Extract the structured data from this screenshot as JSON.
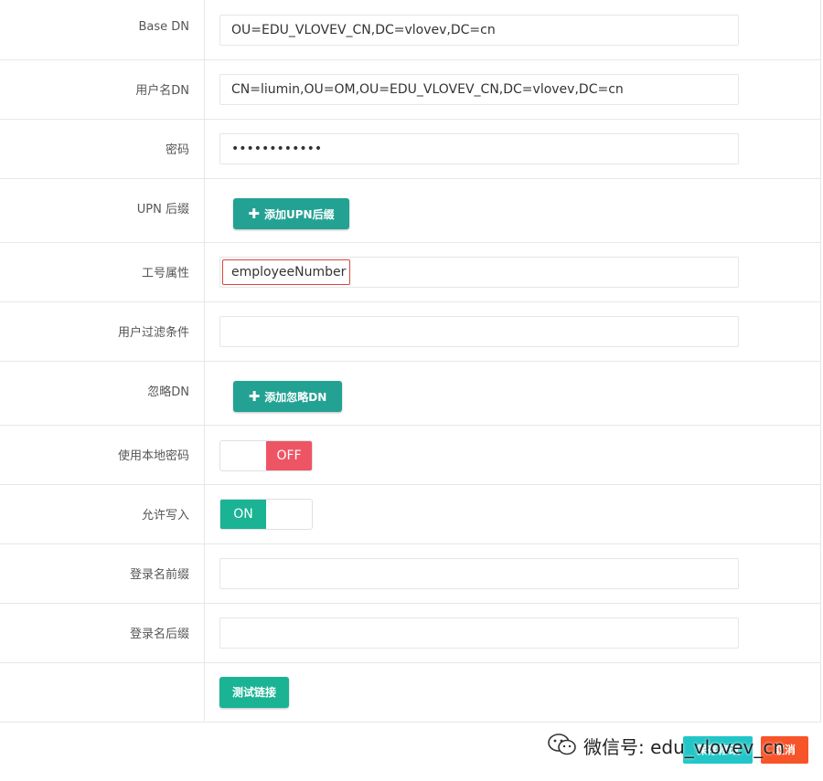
{
  "fields": {
    "base_dn": {
      "label": "Base DN",
      "value": "OU=EDU_VLOVEV_CN,DC=vlovev,DC=cn"
    },
    "user_dn": {
      "label": "用户名DN",
      "value": "CN=liumin,OU=OM,OU=EDU_VLOVEV_CN,DC=vlovev,DC=cn"
    },
    "password": {
      "label": "密码",
      "value": "••••••••••••"
    },
    "upn_suffix": {
      "label": "UPN 后缀",
      "button": "添加UPN后缀"
    },
    "employee_attr": {
      "label": "工号属性",
      "value": "employeeNumber"
    },
    "user_filter": {
      "label": "用户过滤条件",
      "value": ""
    },
    "ignore_dn": {
      "label": "忽略DN",
      "button": "添加忽略DN"
    },
    "use_local_password": {
      "label": "使用本地密码",
      "state": "OFF"
    },
    "allow_write": {
      "label": "允许写入",
      "state": "ON"
    },
    "login_prefix": {
      "label": "登录名前缀",
      "value": ""
    },
    "login_suffix": {
      "label": "登录名后缀",
      "value": ""
    }
  },
  "test_button": "测试链接",
  "footer": {
    "save": "保存修改",
    "cancel": "取消",
    "watermark": "微信号: edu_vlovev_cn"
  },
  "colors": {
    "primary": "#1ab394",
    "off": "#ed5565",
    "save": "#23c6c8",
    "cancel": "#f8542a",
    "highlight_border": "#d9463b"
  }
}
